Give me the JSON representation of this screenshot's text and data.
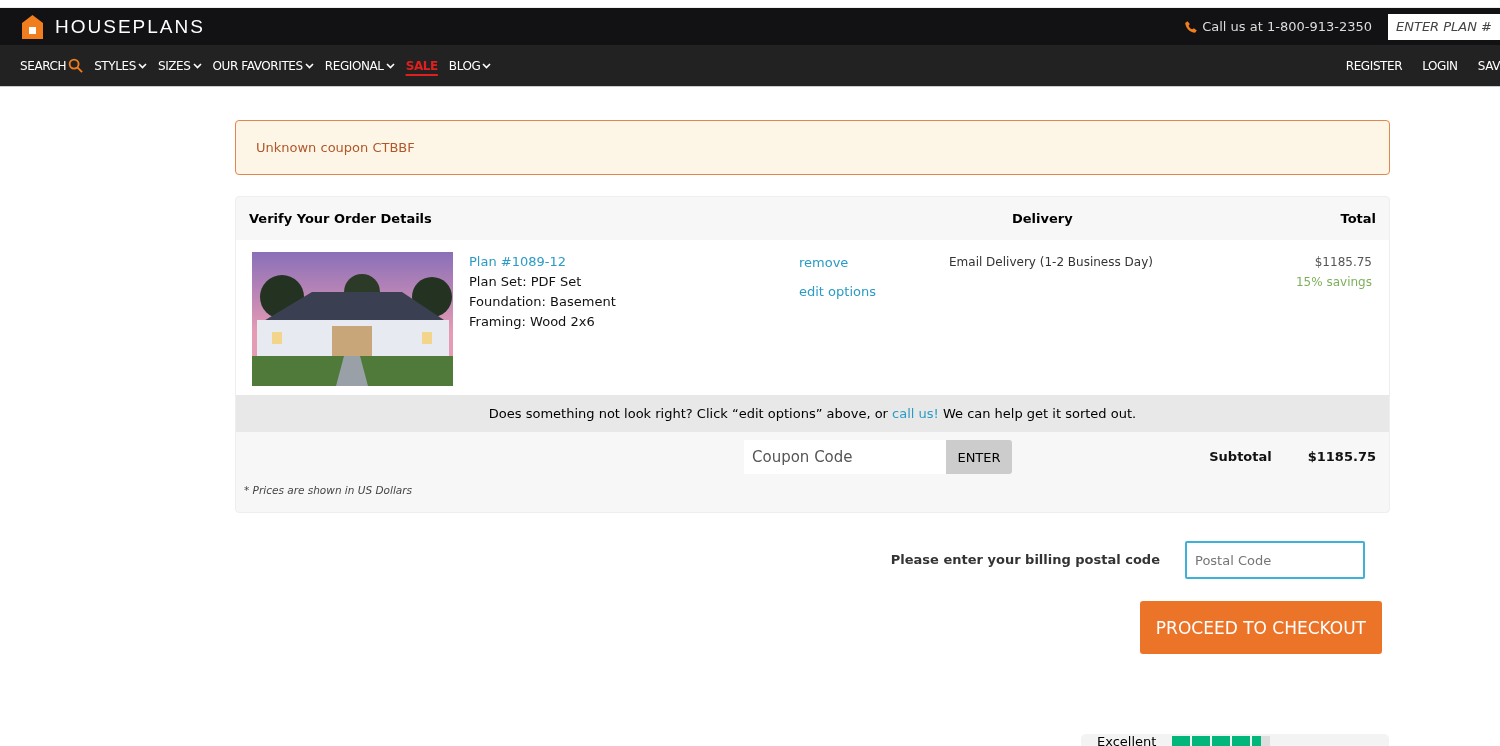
{
  "header": {
    "logo": "HOUSEPLANS",
    "phone": "Call us at 1-800-913-2350",
    "plan_search": {
      "placeholder": "ENTER PLAN #"
    }
  },
  "nav": {
    "left": [
      {
        "label": "SEARCH",
        "kind": "search"
      },
      {
        "label": "STYLES",
        "kind": "menu"
      },
      {
        "label": "SIZES",
        "kind": "menu"
      },
      {
        "label": "OUR FAVORITES",
        "kind": "menu"
      },
      {
        "label": "REGIONAL",
        "kind": "menu"
      },
      {
        "label": "SALE",
        "kind": "sale"
      },
      {
        "label": "BLOG",
        "kind": "menu"
      }
    ],
    "right": [
      "REGISTER",
      "LOGIN",
      "SAV"
    ]
  },
  "alert": "Unknown coupon CTBBF",
  "order": {
    "columns": [
      "Verify Your Order Details",
      "Delivery",
      "Total"
    ],
    "item": {
      "plan": "Plan #1089-12",
      "details": [
        "Plan Set: PDF Set",
        "Foundation: Basement",
        "Framing: Wood 2x6"
      ],
      "actions": [
        "remove",
        "edit options"
      ],
      "delivery": "Email Delivery (1-2 Business Day)",
      "price": "$1185.75",
      "savings": "15% savings"
    },
    "help": {
      "before": "Does something not look right?  Click “edit options” above, or ",
      "link": "call us!",
      "after": "  We can help get it sorted out."
    },
    "coupon": {
      "placeholder": "Coupon Code",
      "button": "ENTER"
    },
    "subtotal_label": "Subtotal",
    "subtotal": "$1185.75",
    "note": "* Prices are shown in US Dollars"
  },
  "billing": {
    "label": "Please enter your billing postal code",
    "placeholder": "Postal Code"
  },
  "checkout": "PROCEED TO CHECKOUT",
  "review": {
    "rating": "Excellent",
    "stars": 4.5
  }
}
